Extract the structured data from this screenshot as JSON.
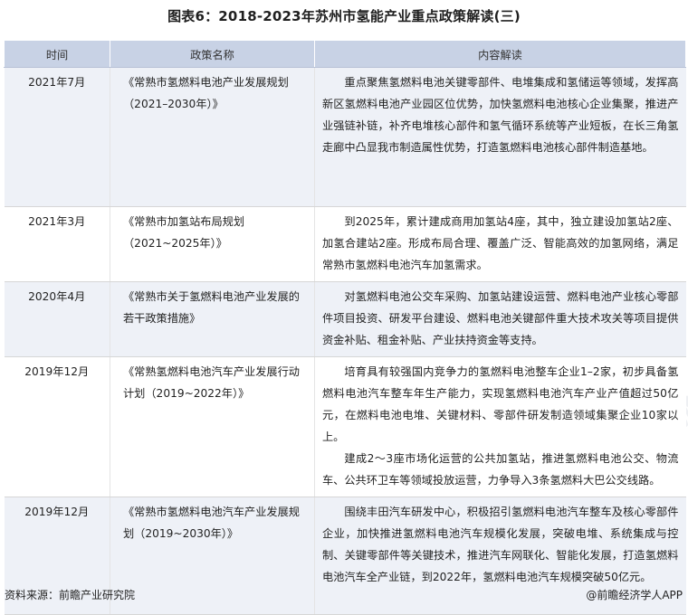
{
  "title": "图表6：2018-2023年苏州市氢能产业重点政策解读(三)",
  "table": {
    "headers": [
      "时间",
      "政策名称",
      "内容解读"
    ],
    "rows": [
      {
        "time": "2021年7月",
        "name": "《常熟市氢燃料电池产业发展规划（2021–2030年）》",
        "content": [
          "重点聚焦氢燃料电池关键零部件、电堆集成和氢储运等领域，发挥高新区氢燃料电池产业园区位优势，加快氢燃料电池核心企业集聚，推进产业强链补链，补齐电堆核心部件和氢气循环系统等产业短板，在长三角氢走廊中凸显我市制造属性优势，打造氢燃料电池核心部件制造基地。"
        ]
      },
      {
        "time": "2021年3月",
        "name": "《常熟市加氢站布局规划（2021~2025年）》",
        "content": [
          "到2025年，累计建成商用加氢站4座，其中，独立建设加氢站2座、加氢合建站2座。形成布局合理、覆盖广泛、智能高效的加氢网络，满足常熟市氢燃料电池汽车加氢需求。"
        ]
      },
      {
        "time": "2020年4月",
        "name": "《常熟市关于氢燃料电池产业发展的若干政策措施》",
        "content": [
          "对氢燃料电池公交车采购、加氢站建设运营、燃料电池产业核心零部件项目投资、研发平台建设、燃料电池关键部件重大技术攻关等项目提供资金补贴、租金补贴、产业扶持资金等支持。"
        ]
      },
      {
        "time": "2019年12月",
        "name": "《常熟氢燃料电池汽车产业发展行动计划（2019~2022年）》",
        "content": [
          "培育具有较强国内竞争力的氢燃料电池整车企业1–2家，初步具备氢燃料电池汽车整车年生产能力，实现氢燃料电池汽车产业产值超过50亿元，在燃料电池电堆、关键材料、零部件研发制造领域集聚企业10家以上。",
          "建成2～3座市场化运营的公共加氢站，推进氢燃料电池公交、物流车、公共环卫车等领域投放运营，力争导入3条氢燃料大巴公交线路。"
        ]
      },
      {
        "time": "2019年12月",
        "name": "《常熟市氢燃料电池汽车产业发展规划（2019~2030年）》",
        "content": [
          "围绕丰田汽车研发中心，积极招引氢燃料电池汽车整车及核心零部件企业，加快推进氢燃料电池汽车规模化发展，突破电堆、系统集成与控制、关键零部件等关键技术，推进汽车网联化、智能化发展，打造氢燃料电池汽车全产业链，到2022年，氢燃料电池汽车规模突破50亿元。"
        ]
      }
    ]
  },
  "watermark": "前瞻产业研究院",
  "footer": {
    "source": "资料来源：前瞻产业研究院",
    "credit": "@前瞻经济学人APP"
  }
}
